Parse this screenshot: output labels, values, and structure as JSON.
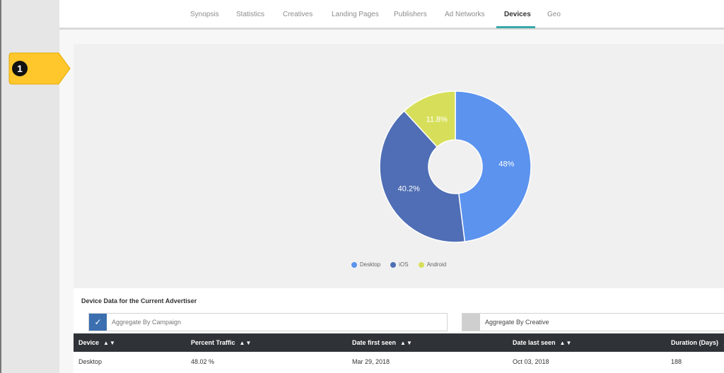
{
  "nav": {
    "tabs": [
      "Synopsis",
      "Statistics",
      "Creatives",
      "Landing Pages",
      "Publishers",
      "Ad Networks",
      "Devices",
      "Geo"
    ],
    "active_tab": "Devices"
  },
  "marker": {
    "number": "1",
    "color": "#ffc72c"
  },
  "chart_data": {
    "type": "pie",
    "style": "donut",
    "categories": [
      "Desktop",
      "iOS",
      "Android"
    ],
    "values": [
      48,
      40.2,
      11.8
    ],
    "labels": [
      "48%",
      "40.2%",
      "11.8%"
    ],
    "colors": [
      "#5b93ee",
      "#4f6eb5",
      "#d7df5a"
    ],
    "legend_position": "bottom"
  },
  "table": {
    "title": "Device Data for the Current Advertiser",
    "aggregate_campaign": "Aggregate By Campaign",
    "aggregate_campaign_checked": true,
    "aggregate_creative": "Aggregate By Creative",
    "aggregate_creative_checked": false,
    "columns": [
      "Device",
      "Percent Traffic",
      "Date first seen",
      "Date last seen",
      "Duration (Days)"
    ],
    "rows": [
      [
        "Desktop",
        "48.02 %",
        "Mar 29, 2018",
        "Oct 03, 2018",
        "188"
      ]
    ]
  }
}
